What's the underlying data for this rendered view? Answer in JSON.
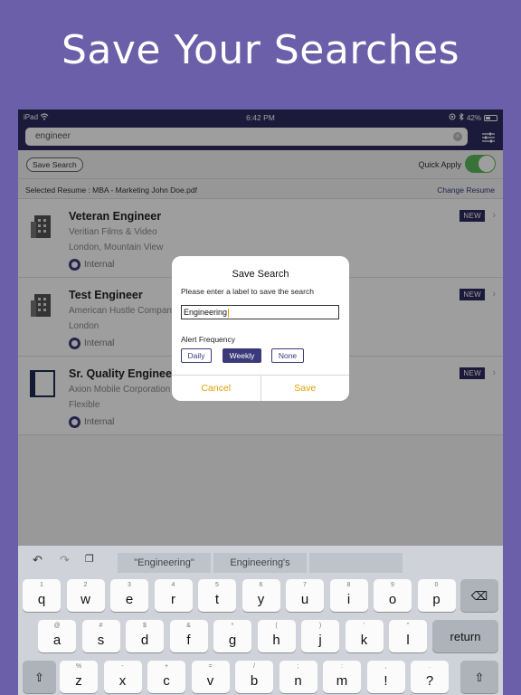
{
  "headline": "Save Your Searches",
  "status_bar": {
    "device": "iPad",
    "time": "6:42 PM",
    "battery": "42%"
  },
  "search": {
    "query": "engineer"
  },
  "toolbar": {
    "save_search": "Save Search",
    "quick_apply": "Quick Apply",
    "quick_apply_on": true
  },
  "resume": {
    "selected": "Selected Resume : MBA - Marketing John Doe.pdf",
    "change": "Change Resume"
  },
  "jobs": [
    {
      "title": "Veteran Engineer",
      "company": "Veritian Films & Video",
      "location": "London, Mountain View",
      "source": "Internal",
      "badge": "NEW"
    },
    {
      "title": "Test Engineer",
      "company": "American Hustle Company",
      "location": "London",
      "source": "Internal",
      "badge": "NEW"
    },
    {
      "title": "Sr. Quality Engineer",
      "company": "Axion Mobile Corporation",
      "location": "Flexible",
      "source": "Internal",
      "badge": "NEW"
    }
  ],
  "dialog": {
    "title": "Save Search",
    "message": "Please enter a label to save the search",
    "input_value": "Engineering",
    "frequency_label": "Alert Frequency",
    "options": [
      "Daily",
      "Weekly",
      "None"
    ],
    "selected_option": "Weekly",
    "cancel": "Cancel",
    "save": "Save"
  },
  "keyboard": {
    "suggestions": [
      "\"Engineering\"",
      "Engineering's",
      ""
    ],
    "row1": [
      {
        "k": "q",
        "s": "1"
      },
      {
        "k": "w",
        "s": "2"
      },
      {
        "k": "e",
        "s": "3"
      },
      {
        "k": "r",
        "s": "4"
      },
      {
        "k": "t",
        "s": "5"
      },
      {
        "k": "y",
        "s": "6"
      },
      {
        "k": "u",
        "s": "7"
      },
      {
        "k": "i",
        "s": "8"
      },
      {
        "k": "o",
        "s": "9"
      },
      {
        "k": "p",
        "s": "0"
      }
    ],
    "row2": [
      {
        "k": "a",
        "s": "@"
      },
      {
        "k": "s",
        "s": "#"
      },
      {
        "k": "d",
        "s": "$"
      },
      {
        "k": "f",
        "s": "&"
      },
      {
        "k": "g",
        "s": "*"
      },
      {
        "k": "h",
        "s": "("
      },
      {
        "k": "j",
        "s": ")"
      },
      {
        "k": "k",
        "s": "'"
      },
      {
        "k": "l",
        "s": "\""
      }
    ],
    "row3": [
      {
        "k": "z",
        "s": "%"
      },
      {
        "k": "x",
        "s": "-"
      },
      {
        "k": "c",
        "s": "+"
      },
      {
        "k": "v",
        "s": "="
      },
      {
        "k": "b",
        "s": "/"
      },
      {
        "k": "n",
        "s": ";"
      },
      {
        "k": "m",
        "s": ":"
      },
      {
        "k": "!",
        "s": ","
      },
      {
        "k": "?",
        "s": "."
      }
    ],
    "return_label": "return"
  },
  "colors": {
    "background": "#6a5fa8",
    "header": "#2e2a5e",
    "accent": "#e0a100",
    "toggle_on": "#5cb85c"
  }
}
